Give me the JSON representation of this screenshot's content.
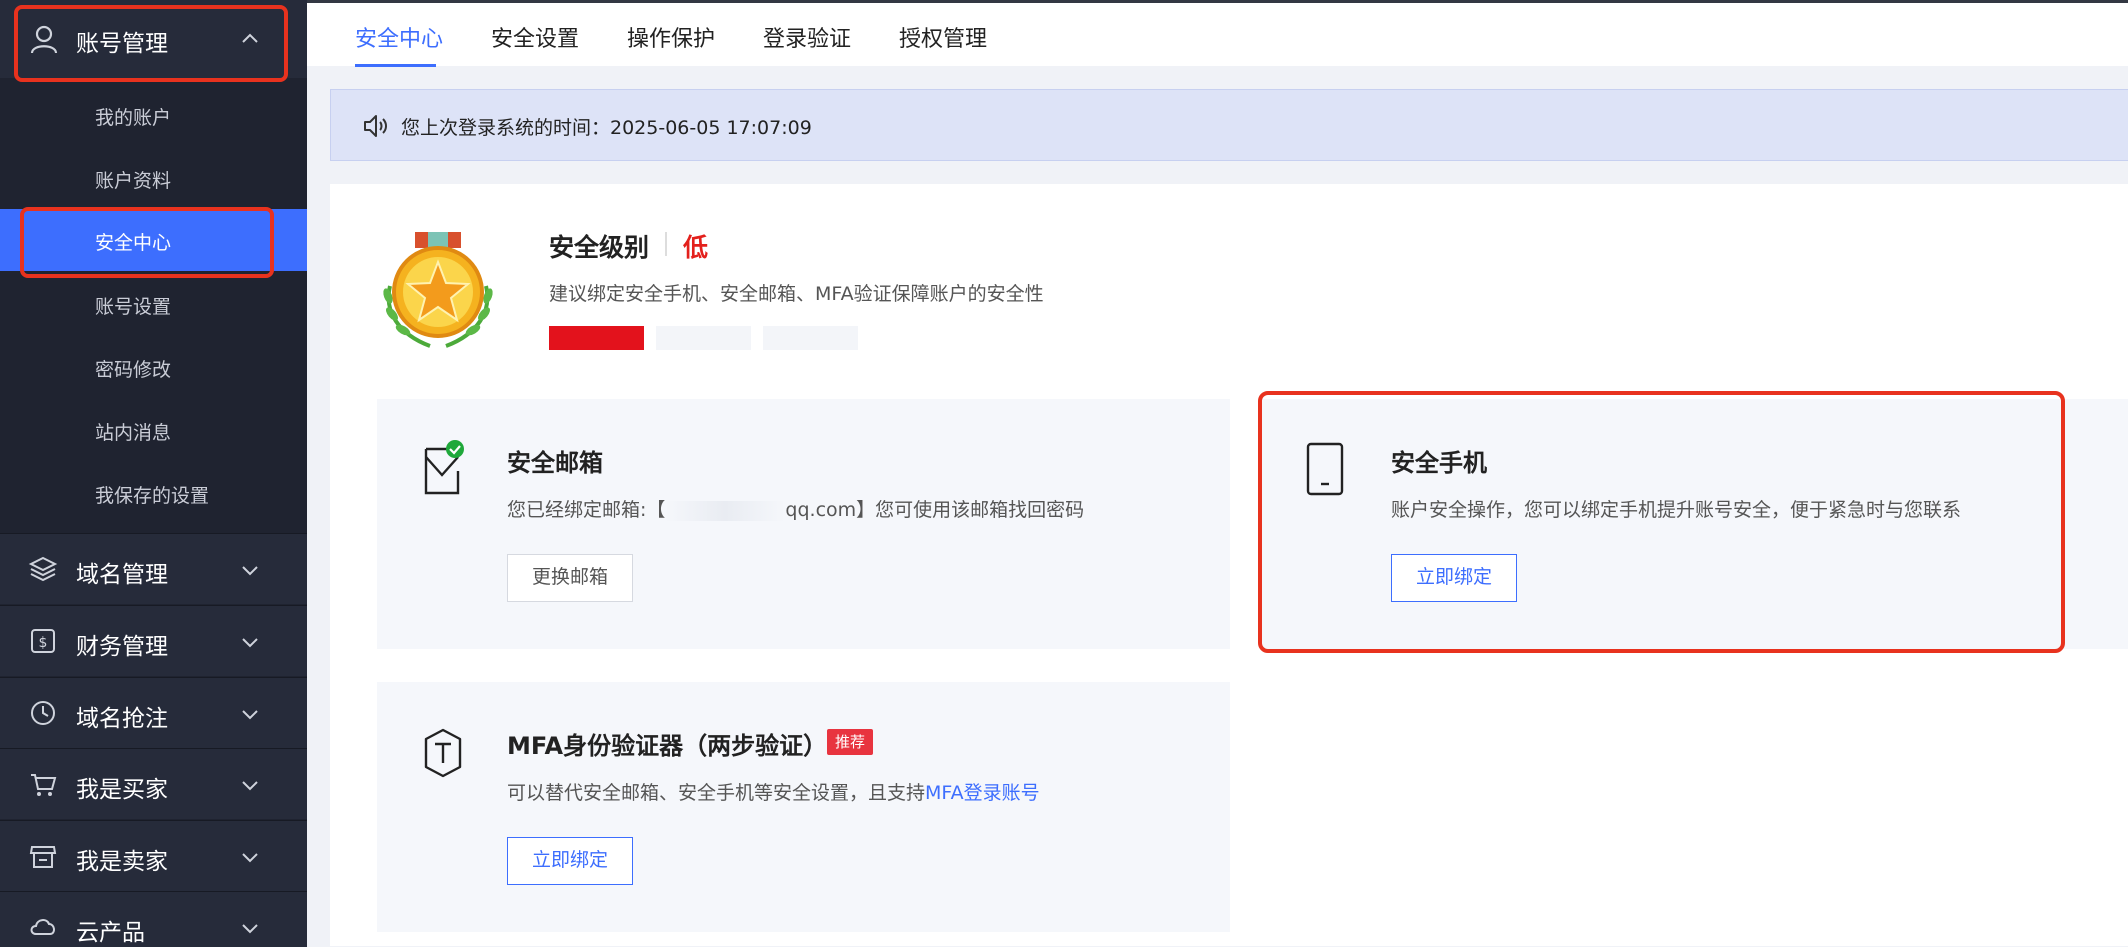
{
  "sidebar": {
    "section_title": "账号管理",
    "items": [
      {
        "label": "我的账户"
      },
      {
        "label": "账户资料"
      },
      {
        "label": "安全中心"
      },
      {
        "label": "账号设置"
      },
      {
        "label": "密码修改"
      },
      {
        "label": "站内消息"
      },
      {
        "label": "我保存的设置"
      }
    ],
    "groups": [
      {
        "label": "域名管理",
        "icon": "layers-icon"
      },
      {
        "label": "财务管理",
        "icon": "dollar-doc-icon"
      },
      {
        "label": "域名抢注",
        "icon": "clock-icon"
      },
      {
        "label": "我是买家",
        "icon": "cart-icon"
      },
      {
        "label": "我是卖家",
        "icon": "store-icon"
      },
      {
        "label": "云产品",
        "icon": "cloud-icon"
      }
    ]
  },
  "tabs": [
    {
      "label": "安全中心",
      "active": true
    },
    {
      "label": "安全设置"
    },
    {
      "label": "操作保护"
    },
    {
      "label": "登录验证"
    },
    {
      "label": "授权管理"
    }
  ],
  "notice": {
    "text": "您上次登录系统的时间：2025-06-05 17:07:09"
  },
  "security": {
    "title": "安全级别",
    "level": "低",
    "description": "建议绑定安全手机、安全邮箱、MFA验证保障账户的安全性",
    "bars_filled": 1,
    "bars_total": 3,
    "colors": {
      "filled": "#e3121c",
      "empty": "#f3f5f9"
    }
  },
  "cards": {
    "email": {
      "title": "安全邮箱",
      "desc_prefix": "您已经绑定邮箱:【",
      "desc_suffix": "qq.com】您可使用该邮箱找回密码",
      "button": "更换邮箱"
    },
    "phone": {
      "title": "安全手机",
      "desc": "账户安全操作，您可以绑定手机提升账号安全，便于紧急时与您联系",
      "button": "立即绑定"
    },
    "mfa": {
      "title": "MFA身份验证器（两步验证）",
      "badge": "推荐",
      "desc_prefix": "可以替代安全邮箱、安全手机等安全设置，且支持",
      "desc_link": "MFA登录账号",
      "button": "立即绑定"
    }
  },
  "colors": {
    "accent": "#3d6efe",
    "sidebar_bg": "#1f2330",
    "highlight": "#e8321e",
    "danger": "#e3201c"
  }
}
